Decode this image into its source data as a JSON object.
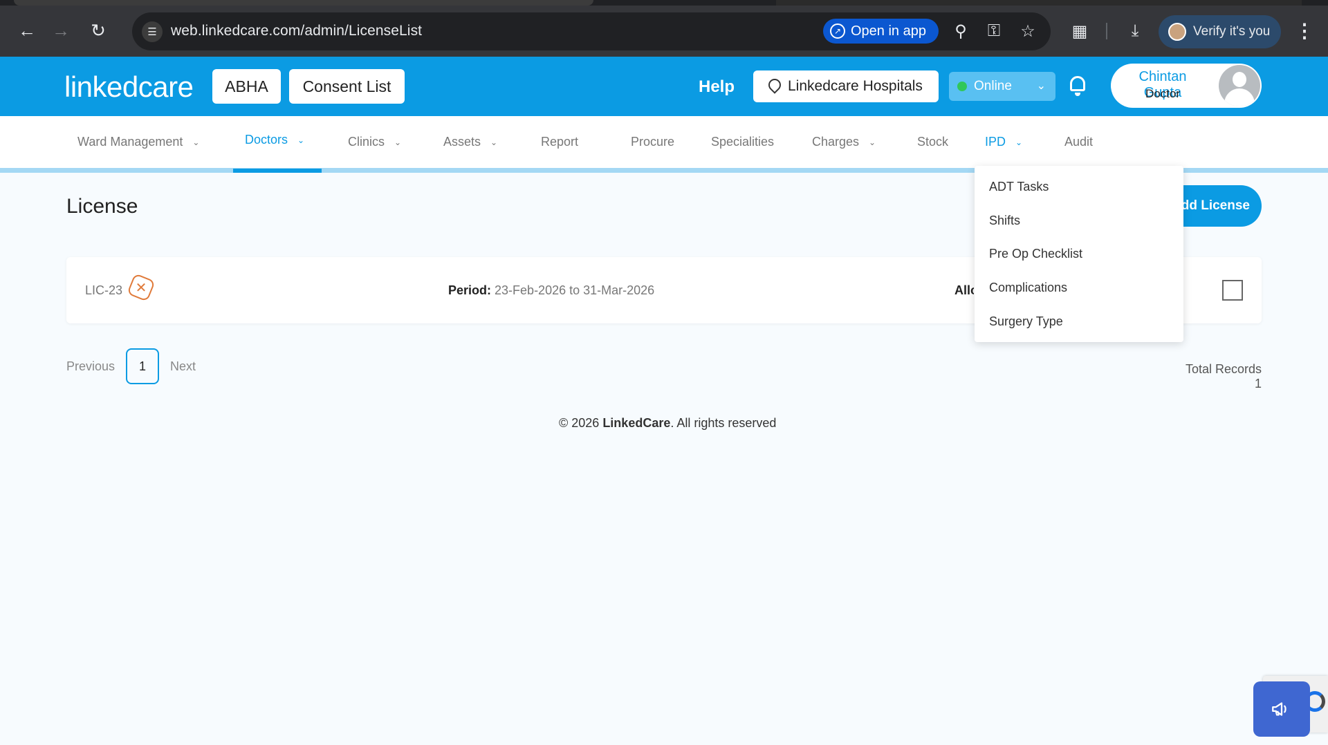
{
  "browser": {
    "url": "web.linkedcare.com/admin/LicenseList",
    "open_in_app_label": "Open in app",
    "verify_label": "Verify it's you",
    "icons": [
      "back-icon",
      "forward-icon",
      "reload-icon",
      "site-settings-icon",
      "zoom-icon",
      "password-key-icon",
      "bookmark-star-icon",
      "extensions-icon",
      "download-icon",
      "more-menu-icon"
    ]
  },
  "header": {
    "logo": "linkedcare",
    "abha_label": "ABHA",
    "consent_label": "Consent List",
    "help_label": "Help",
    "hospital_label": "Linkedcare Hospitals",
    "status_label": "Online",
    "user_name": "Chintan Gupta",
    "user_role": "Doctor",
    "brand_color": "#0b9be3"
  },
  "menu": {
    "items": [
      {
        "label": "Ward Management"
      },
      {
        "label": "Doctors"
      },
      {
        "label": "Clinics"
      },
      {
        "label": "Assets"
      },
      {
        "label": "Report"
      },
      {
        "label": "Procure"
      },
      {
        "label": "Specialities"
      },
      {
        "label": "Charges"
      },
      {
        "label": "Stock"
      },
      {
        "label": "IPD"
      },
      {
        "label": "Audit"
      }
    ],
    "active": "Doctors"
  },
  "dropdown": {
    "parent": "IPD",
    "items": [
      "ADT Tasks",
      "Shifts",
      "Pre Op Checklist",
      "Complications",
      "Surgery Type"
    ]
  },
  "page": {
    "title": "License",
    "add_button": "Add License",
    "row": {
      "id": "LIC-23",
      "period_label": "Period:",
      "period_value": "23-Feb-2026 to 31-Mar-2026",
      "alloc_label": "Allo"
    },
    "pagination": {
      "previous": "Previous",
      "current_page": "1",
      "next": "Next"
    },
    "total_records": "Total Records 1"
  },
  "footer": {
    "prefix": "© 2026 ",
    "brand": "LinkedCare",
    "suffix": ". All rights reserved"
  }
}
